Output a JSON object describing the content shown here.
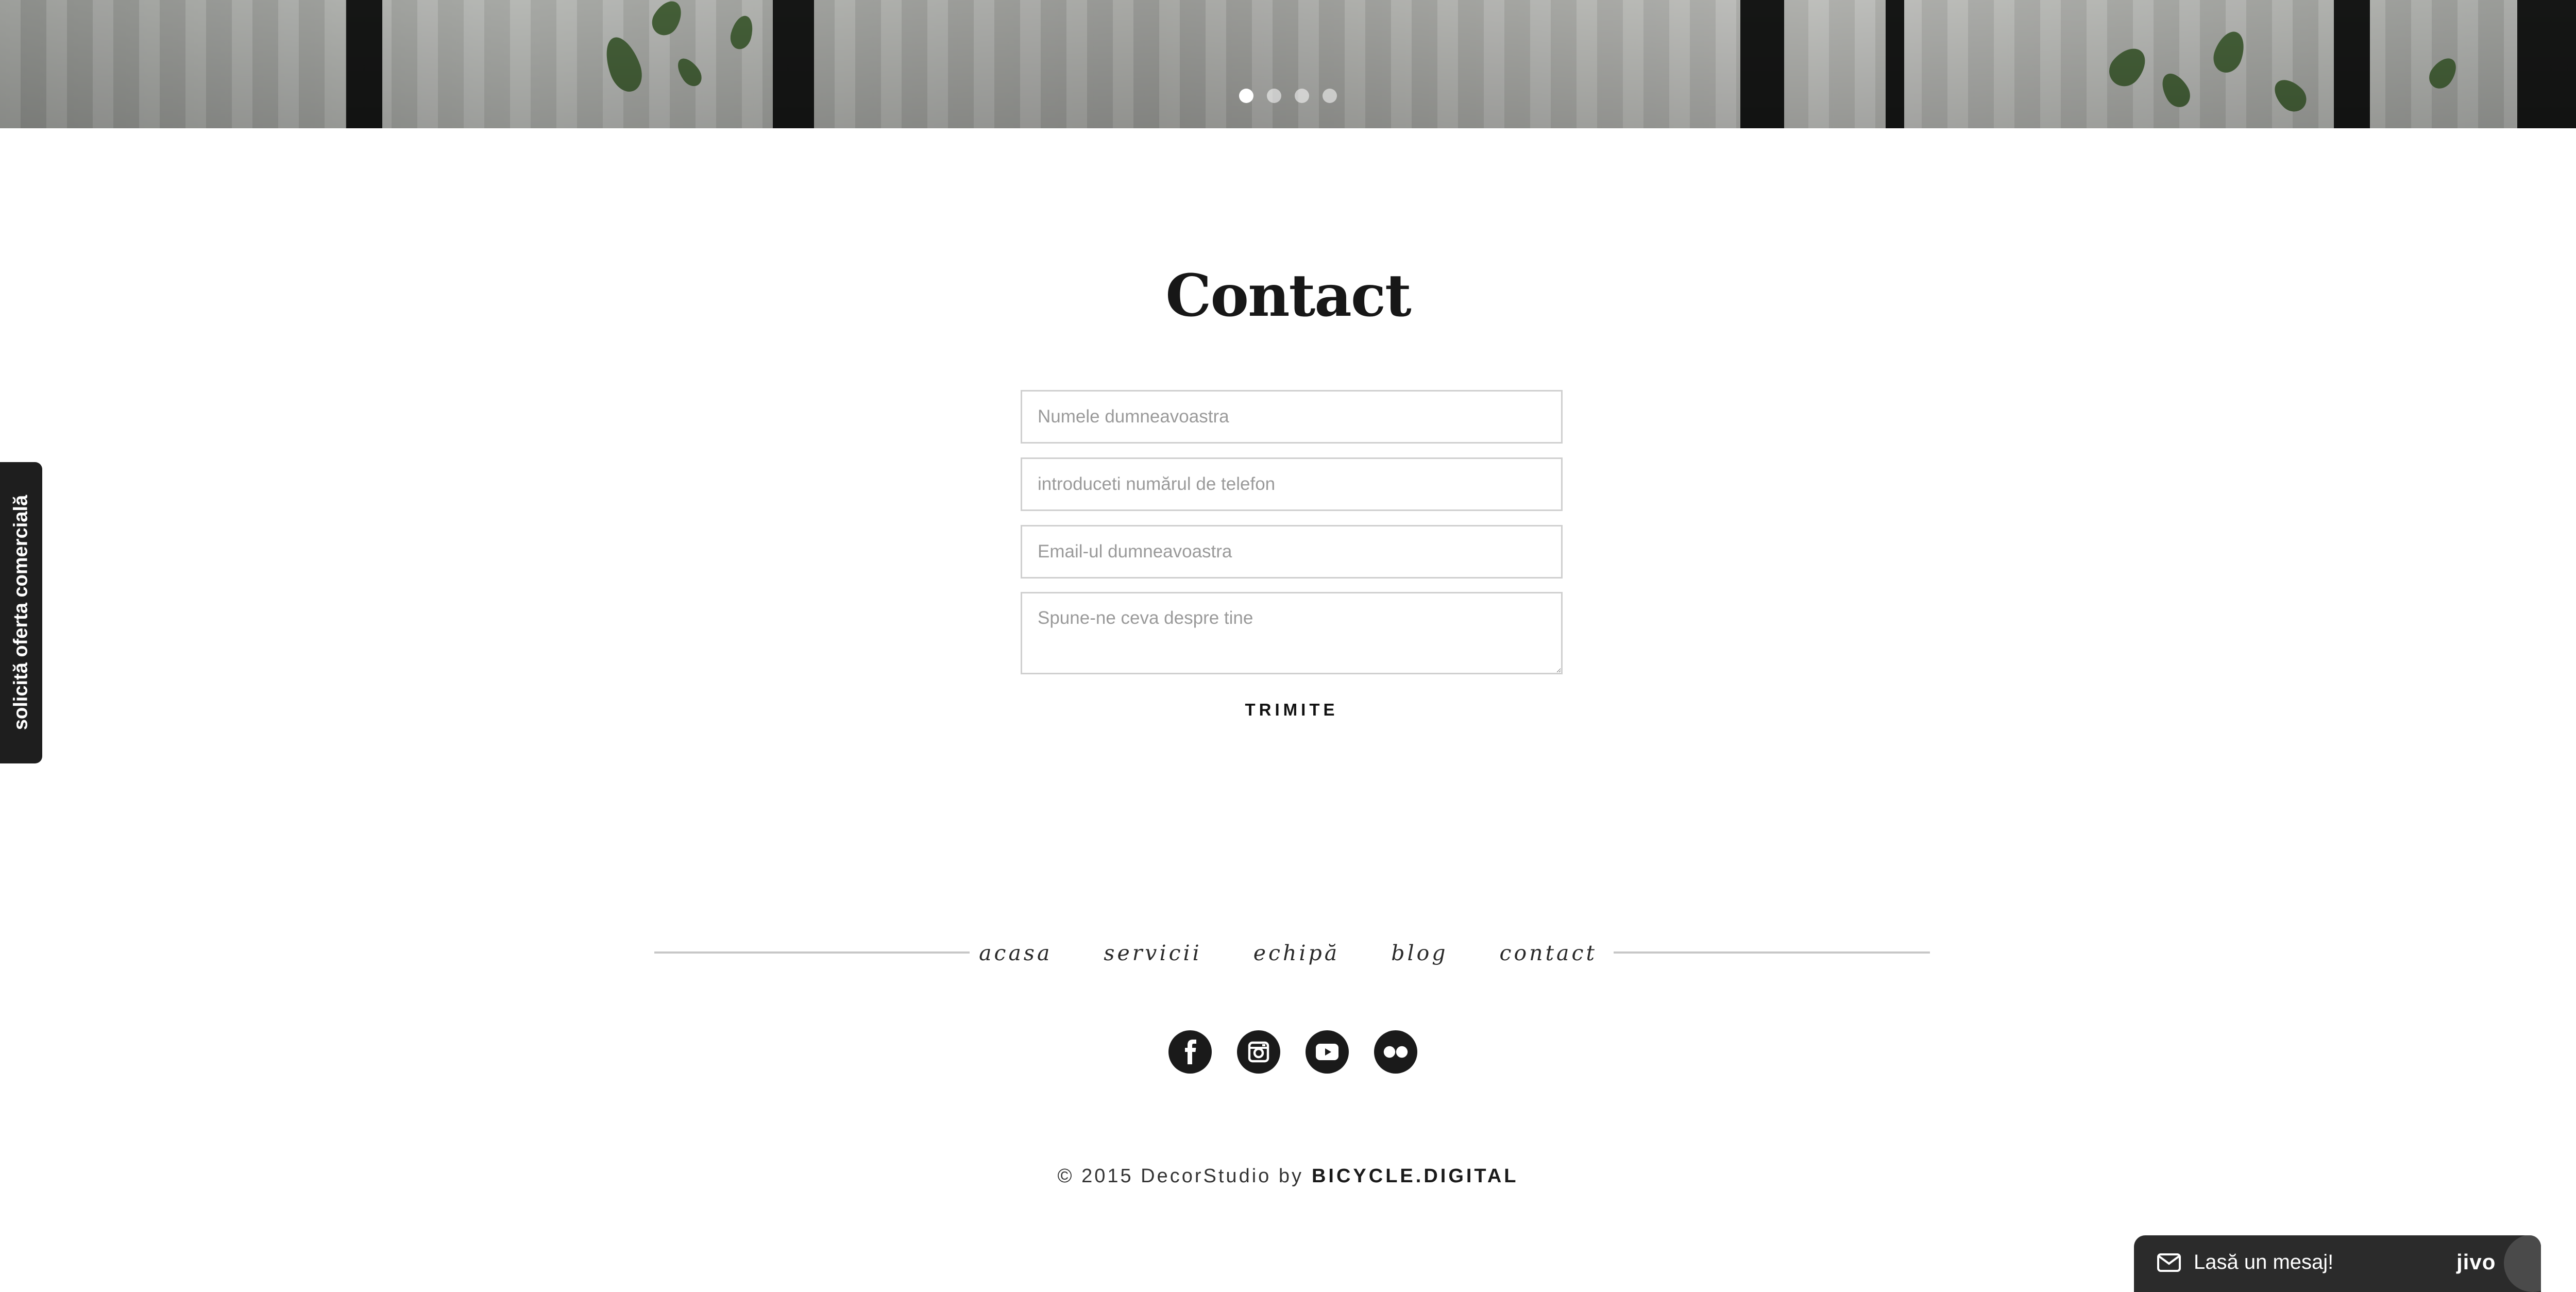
{
  "hero": {
    "slides": [
      {
        "active": true
      },
      {
        "active": false
      },
      {
        "active": false
      },
      {
        "active": false
      }
    ]
  },
  "contact": {
    "title": "Contact",
    "name_placeholder": "Numele dumneavoastra",
    "phone_placeholder": "introduceti numărul de telefon",
    "email_placeholder": "Email-ul dumneavoastra",
    "message_placeholder": "Spune-ne ceva despre tine",
    "submit_label": "TRIMITE"
  },
  "side_tab": {
    "label": "solicită oferta comercială"
  },
  "footer": {
    "nav": [
      "acasa",
      "servicii",
      "echipă",
      "blog",
      "contact"
    ],
    "socials": [
      "facebook-icon",
      "instagram-icon",
      "youtube-icon",
      "flickr-icon"
    ],
    "copyright": "© 2015 DecorStudio by",
    "brand": "BICYCLE.DIGITAL"
  },
  "chat": {
    "message": "Lasă un mesaj!",
    "logo": "jivo"
  },
  "colors": {
    "text": "#1d1d1d",
    "field_border": "#cfcfcf",
    "placeholder": "#9a9a9a",
    "dark_ui": "#1e1e1e",
    "rule": "#c7c7c7"
  }
}
